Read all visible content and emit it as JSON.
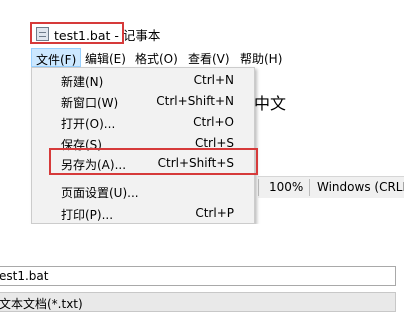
{
  "window": {
    "title": "test1.bat - 记事本",
    "menus": [
      "文件(F)",
      "编辑(E)",
      "格式(O)",
      "查看(V)",
      "帮助(H)"
    ]
  },
  "document": {
    "visible_text": "中文"
  },
  "status_bar": {
    "zoom": "100%",
    "line_ending": "Windows (CRLF)"
  },
  "file_menu": {
    "items": [
      {
        "label": "新建(N)",
        "shortcut": "Ctrl+N"
      },
      {
        "label": "新窗口(W)",
        "shortcut": "Ctrl+Shift+N"
      },
      {
        "label": "打开(O)...",
        "shortcut": "Ctrl+O"
      },
      {
        "label": "保存(S)",
        "shortcut": "Ctrl+S"
      },
      {
        "label": "另存为(A)...",
        "shortcut": "Ctrl+Shift+S"
      },
      {
        "label": "页面设置(U)...",
        "shortcut": ""
      },
      {
        "label": "打印(P)...",
        "shortcut": "Ctrl+P"
      }
    ]
  },
  "save_dialog": {
    "file_name": "est1.bat",
    "file_type": "文本文档(*.txt)"
  },
  "colors": {
    "highlight_outline": "#d63a3a",
    "menu_active": "#cce8ff"
  },
  "icons": {
    "app_icon": "notepad-icon"
  }
}
